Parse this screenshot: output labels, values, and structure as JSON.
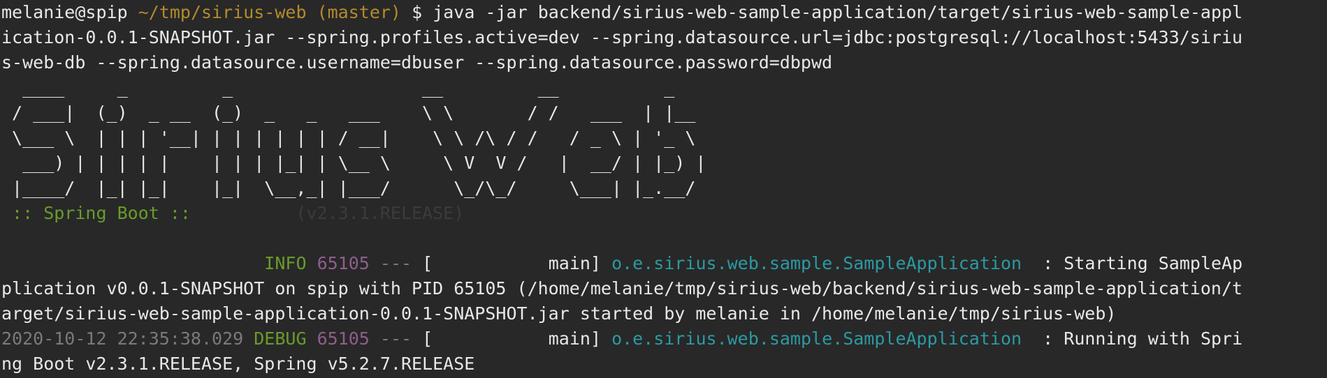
{
  "prompt": {
    "user_host": "melanie@spip",
    "path": "~/tmp/sirius-web",
    "branch": "(master)",
    "symbol": "$"
  },
  "command_lines": [
    "java -jar backend/sirius-web-sample-application/target/sirius-web-sample-appl",
    "ication-0.0.1-SNAPSHOT.jar --spring.profiles.active=dev --spring.datasource.url=jdbc:postgresql://localhost:5433/siriu",
    "s-web-db --spring.datasource.username=dbuser --spring.datasource.password=dbpwd"
  ],
  "banner_lines": [
    "  ____     _         _                  __         __          _",
    " / ___|  (_)  _ __  (_)  _   _   ___    \\ \\       / /   ___  | |__",
    " \\___ \\  | | | '__| | | | | | | / __|    \\ \\ /\\ / /   / _ \\ | '_ \\",
    "  ___) | | | | |    | | | |_| | \\__ \\     \\ V  V /   |  __/ | |_) |",
    " |____/  |_| |_|    |_|  \\__,_| |___/      \\_/\\_/     \\___| |_.__/"
  ],
  "spring_boot": {
    "label": " :: Spring Boot ::",
    "version": "(v2.3.1.RELEASE)"
  },
  "logs": [
    {
      "timestamp": "",
      "level": "INFO",
      "pid": "65105",
      "sep": "---",
      "thread": "[           main]",
      "logger": "o.e.sirius.web.sample.SampleApplication",
      "message_first": " : Starting SampleAp",
      "continuation": [
        "plication v0.0.1-SNAPSHOT on spip with PID 65105 (/home/melanie/tmp/sirius-web/backend/sirius-web-sample-application/t",
        "arget/sirius-web-sample-application-0.0.1-SNAPSHOT.jar started by melanie in /home/melanie/tmp/sirius-web)"
      ]
    },
    {
      "timestamp": "2020-10-12 22:35:38.029",
      "level": "DEBUG",
      "pid": "65105",
      "sep": "---",
      "thread": "[           main]",
      "logger": "o.e.sirius.web.sample.SampleApplication",
      "message_first": " : Running with Spri",
      "continuation": [
        "ng Boot v2.3.1.RELEASE, Spring v5.2.7.RELEASE"
      ]
    }
  ]
}
